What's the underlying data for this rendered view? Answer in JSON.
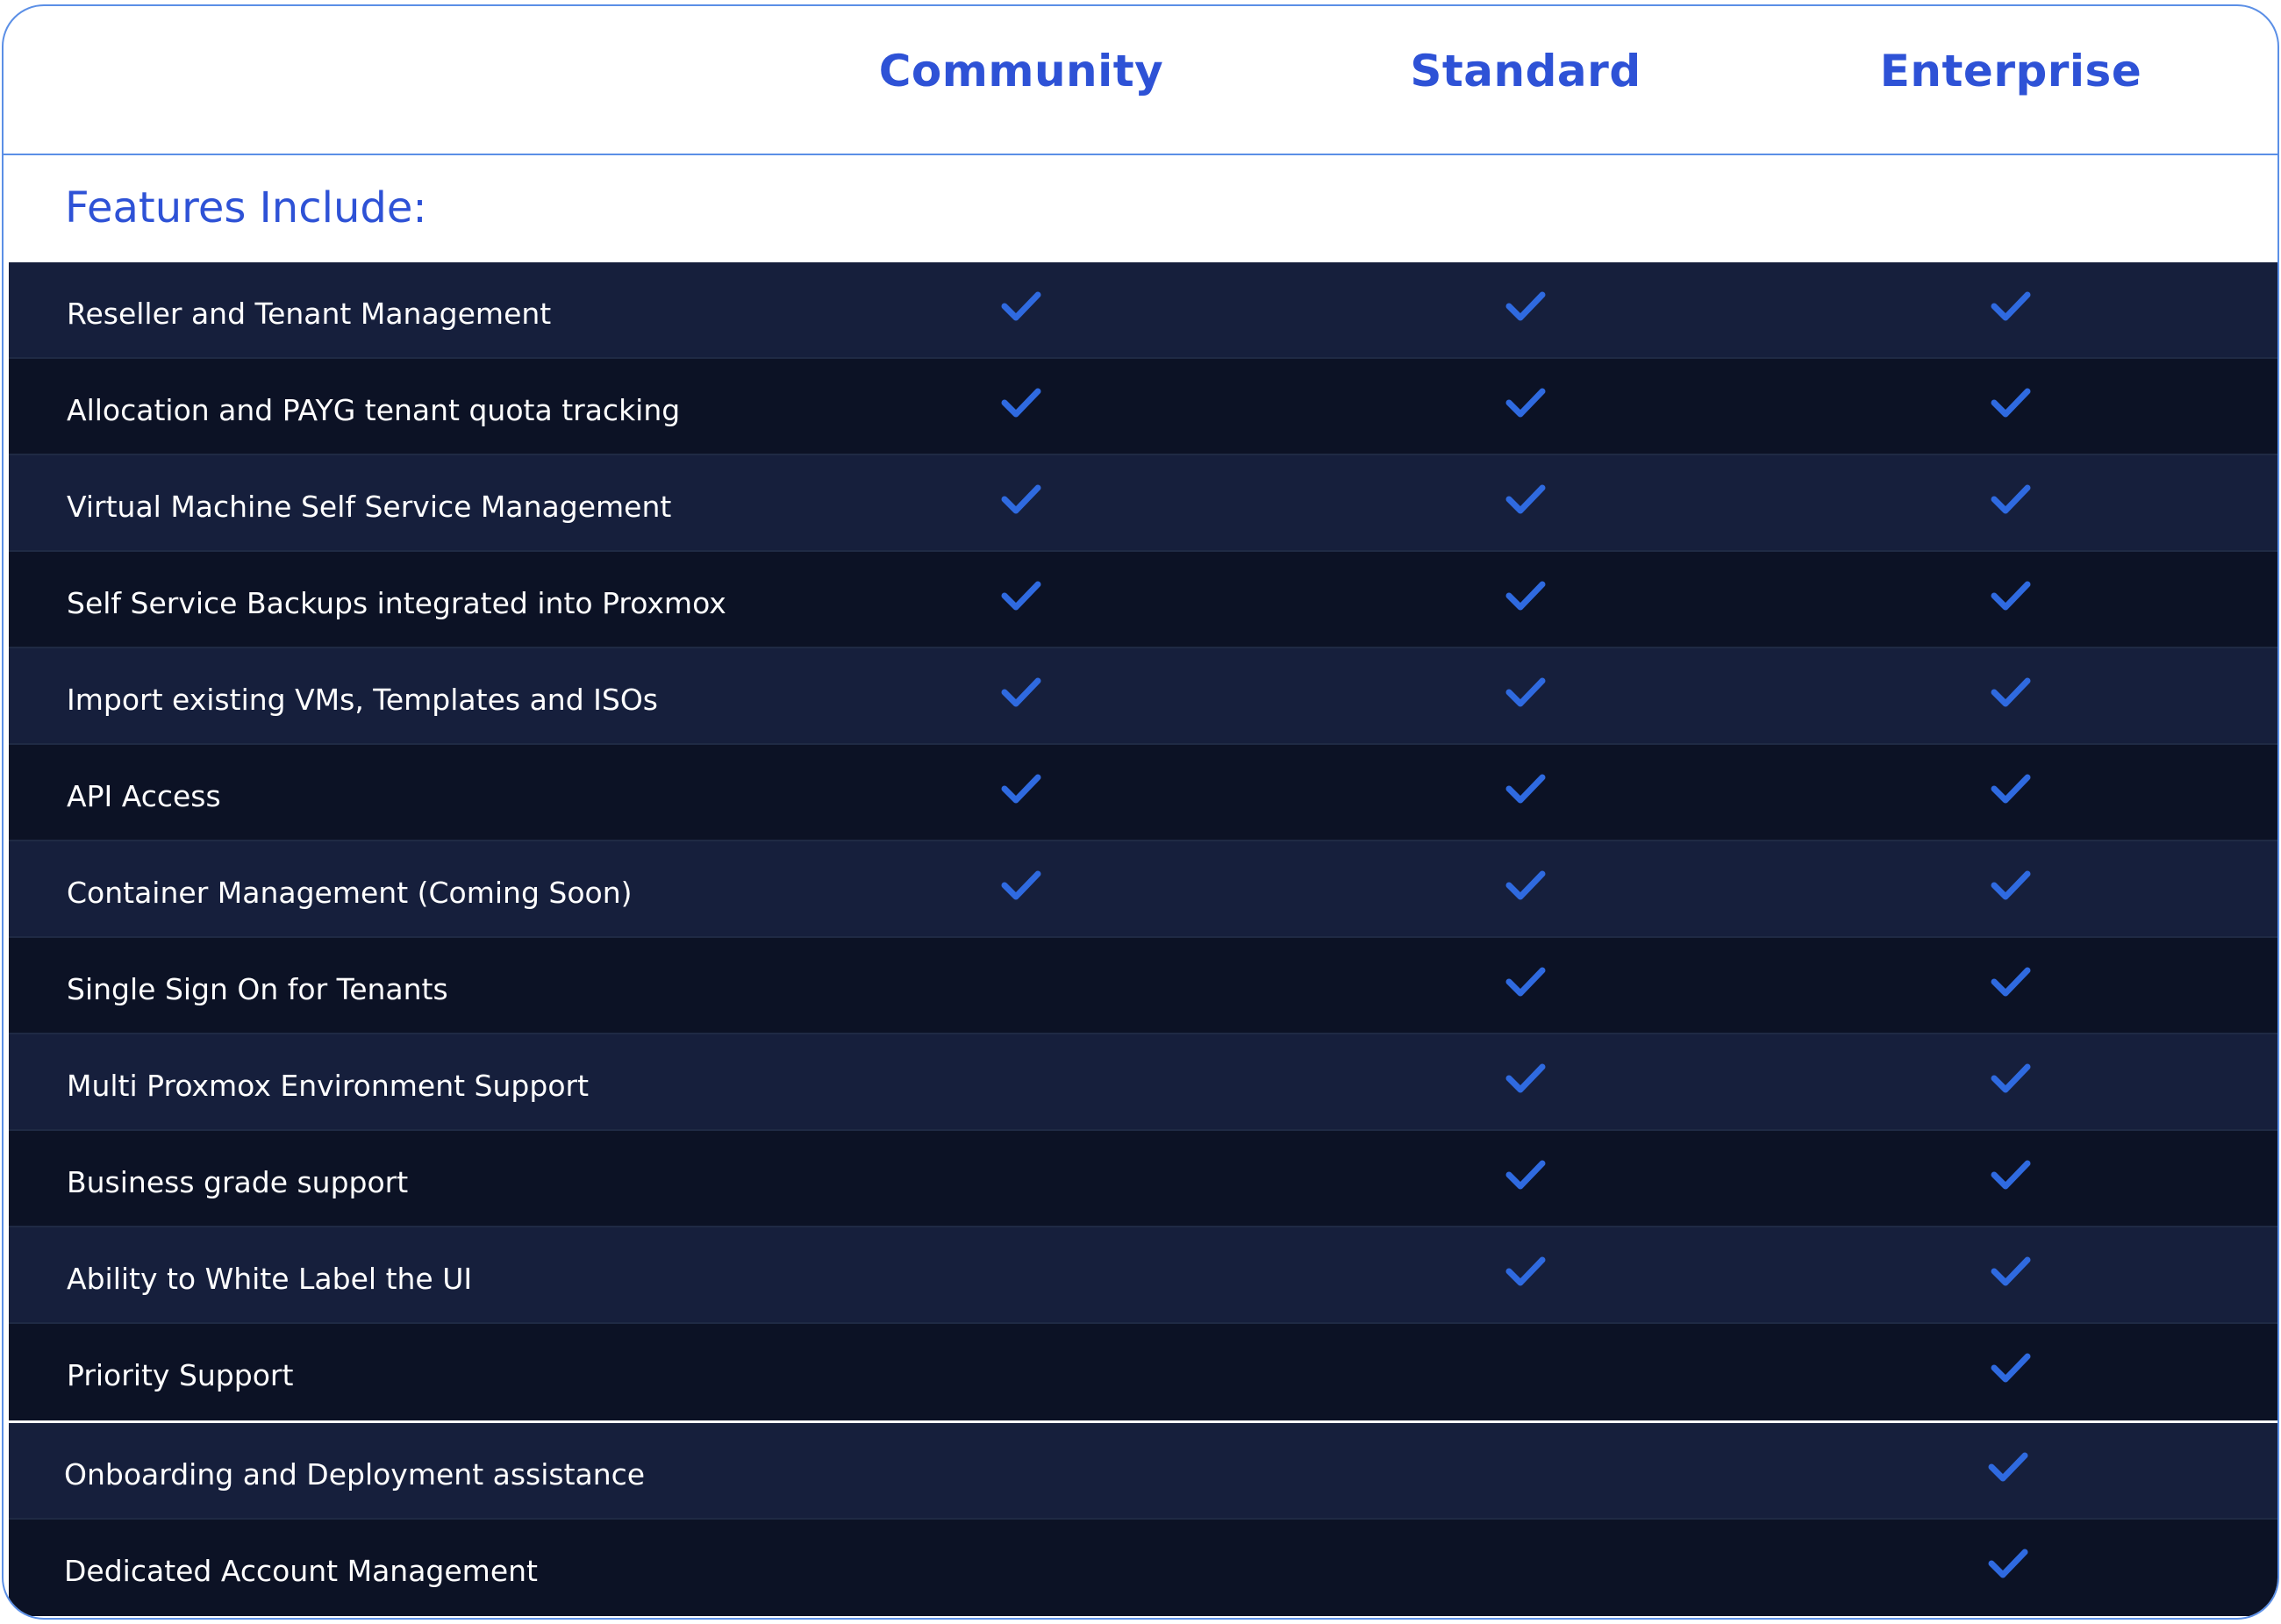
{
  "colors": {
    "accent": "#2e52d6",
    "check": "#2f6ae0",
    "row_light": "#161f3c",
    "row_dark": "#0c1225",
    "border": "#5b8fe6"
  },
  "plans": {
    "community": "Community",
    "standard": "Standard",
    "enterprise": "Enterprise"
  },
  "section_title": "Features Include:",
  "check_icon": "checkmark-icon",
  "features": [
    {
      "label": "Reseller and Tenant Management",
      "community": true,
      "standard": true,
      "enterprise": true
    },
    {
      "label": "Allocation and PAYG tenant quota tracking",
      "community": true,
      "standard": true,
      "enterprise": true
    },
    {
      "label": "Virtual Machine Self Service Management",
      "community": true,
      "standard": true,
      "enterprise": true
    },
    {
      "label": "Self Service Backups integrated into Proxmox",
      "community": true,
      "standard": true,
      "enterprise": true
    },
    {
      "label": "Import existing VMs, Templates and ISOs",
      "community": true,
      "standard": true,
      "enterprise": true
    },
    {
      "label": "API Access",
      "community": true,
      "standard": true,
      "enterprise": true
    },
    {
      "label": "Container Management (Coming Soon)",
      "community": true,
      "standard": true,
      "enterprise": true
    },
    {
      "label": "Single Sign On for Tenants",
      "community": false,
      "standard": true,
      "enterprise": true
    },
    {
      "label": "Multi Proxmox Environment Support",
      "community": false,
      "standard": true,
      "enterprise": true
    },
    {
      "label": "Business grade support",
      "community": false,
      "standard": true,
      "enterprise": true
    },
    {
      "label": "Ability to White Label the UI",
      "community": false,
      "standard": true,
      "enterprise": true
    },
    {
      "label": "Priority Support",
      "community": false,
      "standard": false,
      "enterprise": true
    }
  ],
  "extra_features": [
    {
      "label": "Onboarding and Deployment assistance",
      "community": false,
      "standard": false,
      "enterprise": true
    },
    {
      "label": "Dedicated Account Management",
      "community": false,
      "standard": false,
      "enterprise": true
    }
  ]
}
